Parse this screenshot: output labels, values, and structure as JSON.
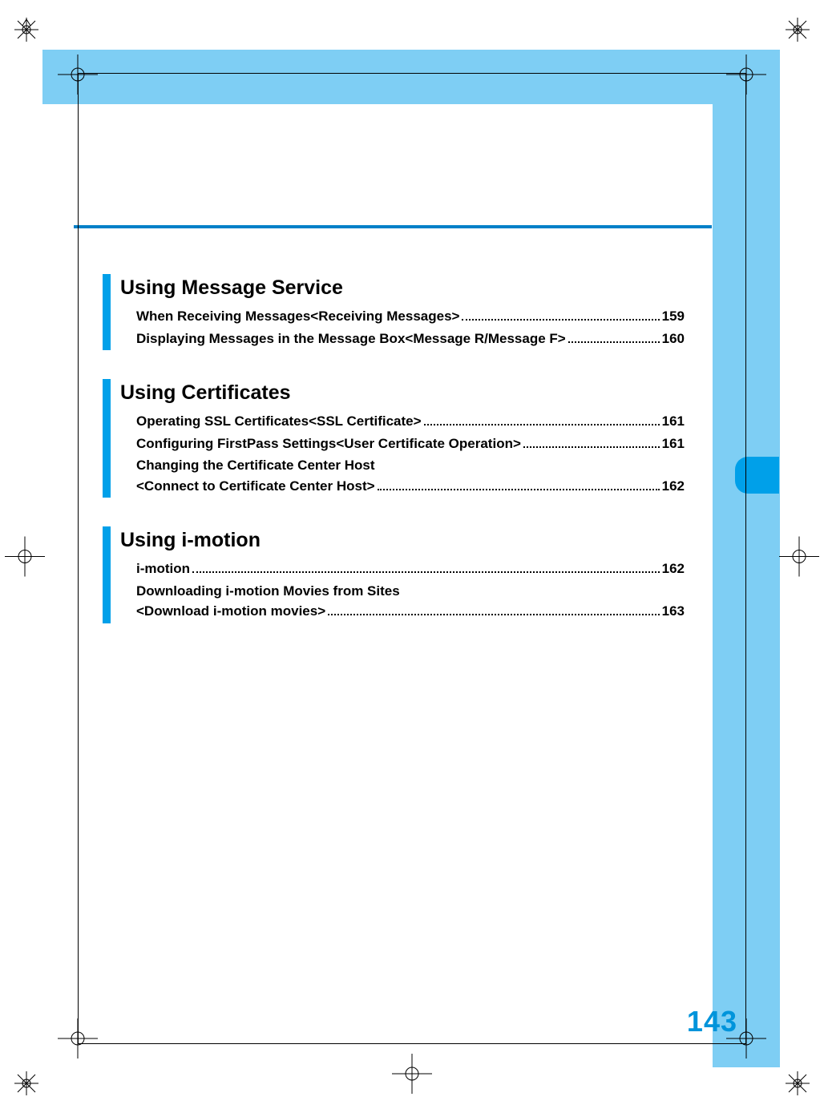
{
  "page_number": "143",
  "sections": [
    {
      "title": "Using Message Service",
      "entries": [
        {
          "text": "When Receiving Messages<Receiving Messages>",
          "page": "159"
        },
        {
          "text": "Displaying Messages in the Message Box<Message R/Message F>",
          "page": "160"
        }
      ]
    },
    {
      "title": "Using Certificates",
      "entries": [
        {
          "text": "Operating SSL Certificates<SSL Certificate>",
          "page": "161"
        },
        {
          "text": "Configuring FirstPass Settings<User Certificate Operation>",
          "page": "161"
        },
        {
          "line1": "Changing the Certificate Center Host",
          "line2": "<Connect to Certificate Center Host>",
          "page": "162"
        }
      ]
    },
    {
      "title": "Using i-motion",
      "entries": [
        {
          "text": "i-motion",
          "page": "162"
        },
        {
          "line1": "Downloading i-motion Movies from Sites",
          "line2": "<Download i-motion movies>",
          "page": "163"
        }
      ]
    }
  ]
}
